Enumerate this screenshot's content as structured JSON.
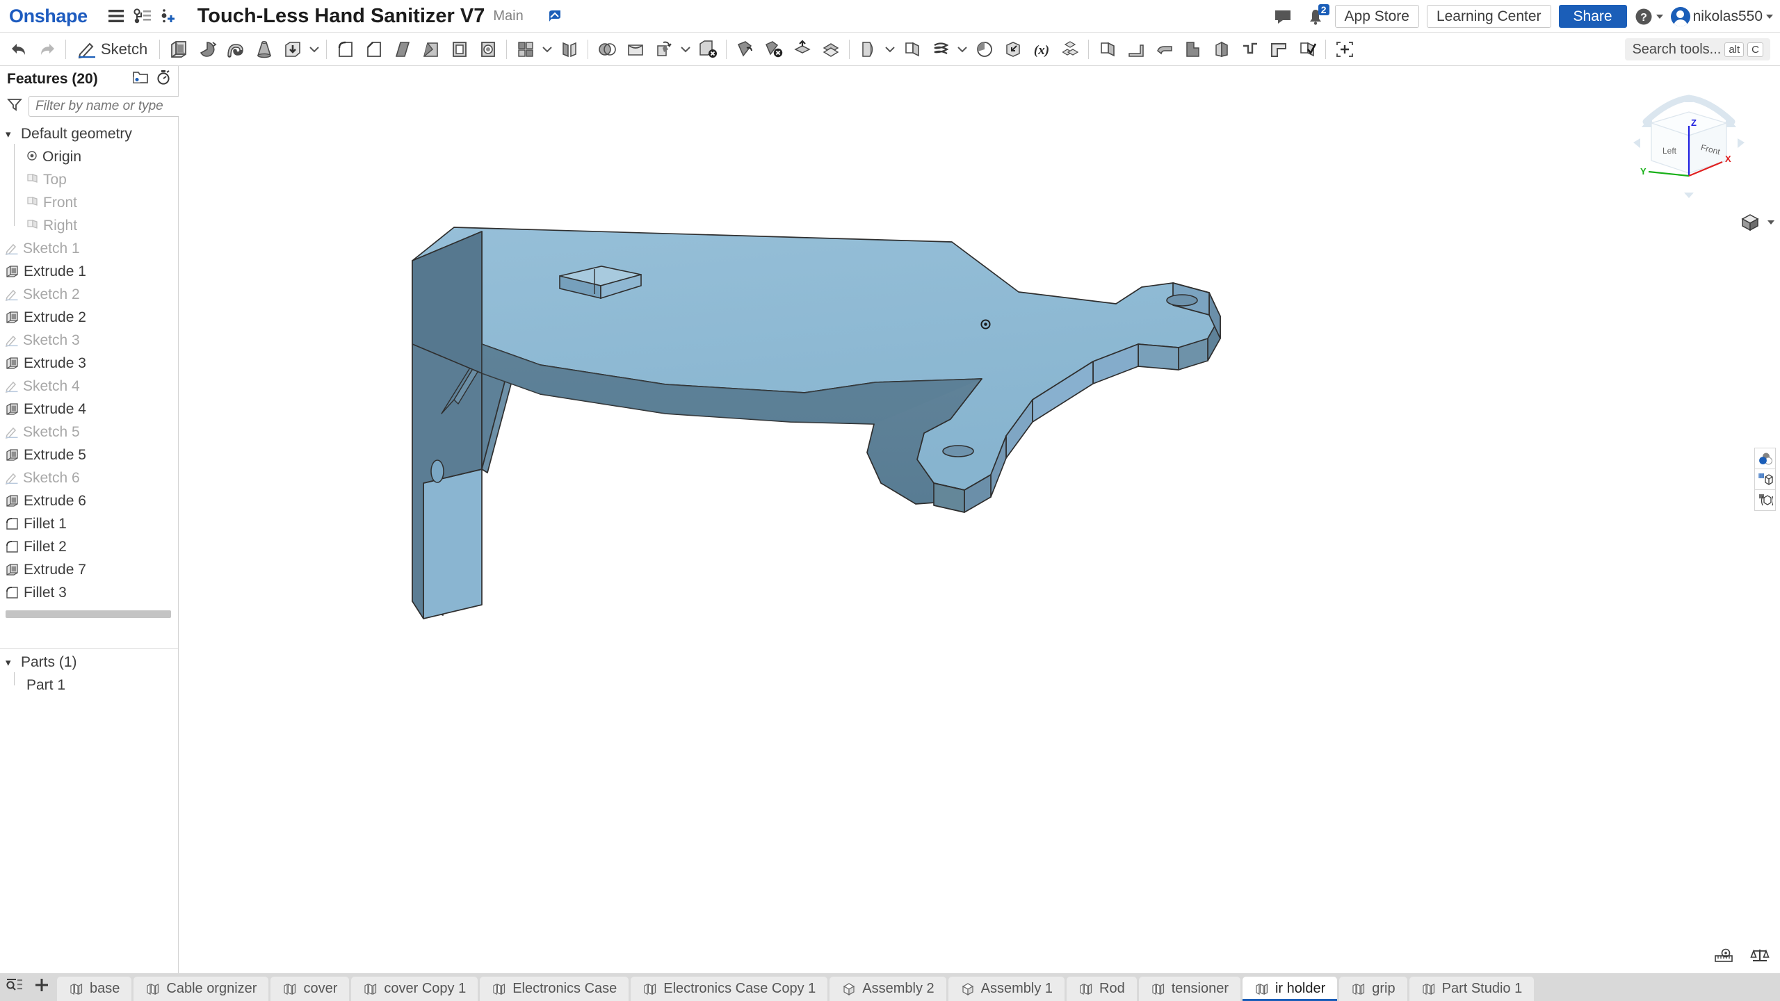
{
  "app": {
    "logo": "Onshape",
    "document_title": "Touch-Less Hand Sanitizer V7",
    "branch": "Main"
  },
  "topbar": {
    "icons": [
      {
        "name": "menu-icon",
        "label": "Menu"
      },
      {
        "name": "version-graph-icon",
        "label": "Versions and history"
      },
      {
        "name": "insert-version-icon",
        "label": "Add version"
      },
      {
        "name": "branch-icon",
        "label": "Branch"
      }
    ],
    "comments_icon": "comment-icon",
    "notifications_icon": "bell-icon",
    "notification_count": "2",
    "app_store_label": "App Store",
    "learning_center_label": "Learning Center",
    "share_label": "Share",
    "help_icon": "help-icon",
    "username": "nikolas550"
  },
  "toolbar": {
    "undo_icon": "undo-icon",
    "redo_icon": "redo-icon",
    "sketch_label": "Sketch",
    "sketch_icon": "sketch-pencil-icon",
    "groups": [
      {
        "name": "create-features",
        "tools": [
          {
            "name": "extrude-icon",
            "label": "Extrude"
          },
          {
            "name": "revolve-icon",
            "label": "Revolve"
          },
          {
            "name": "sweep-icon",
            "label": "Sweep"
          },
          {
            "name": "loft-icon",
            "label": "Loft"
          },
          {
            "name": "thicken-icon",
            "label": "Thicken"
          },
          {
            "name": "more-create-dropdown",
            "label": "More create"
          }
        ]
      },
      {
        "name": "modify-features",
        "tools": [
          {
            "name": "fillet-icon",
            "label": "Fillet"
          },
          {
            "name": "chamfer-icon",
            "label": "Chamfer"
          },
          {
            "name": "rib-icon",
            "label": "Rib"
          },
          {
            "name": "draft-icon",
            "label": "Draft"
          },
          {
            "name": "shell-icon",
            "label": "Shell"
          },
          {
            "name": "hole-icon",
            "label": "Hole"
          },
          {
            "name": "thread-icon",
            "label": "Thread"
          }
        ]
      },
      {
        "name": "pattern-features",
        "tools": [
          {
            "name": "pattern-icon",
            "label": "Pattern"
          },
          {
            "name": "pattern-dropdown",
            "label": "Pattern options"
          },
          {
            "name": "mirror-icon",
            "label": "Mirror"
          }
        ]
      },
      {
        "name": "boolean-features",
        "tools": [
          {
            "name": "boolean-icon",
            "label": "Boolean"
          },
          {
            "name": "split-icon",
            "label": "Split"
          },
          {
            "name": "transform-icon",
            "label": "Transform"
          },
          {
            "name": "transform-dropdown",
            "label": "Transform options"
          },
          {
            "name": "delete-part-icon",
            "label": "Delete part"
          }
        ]
      },
      {
        "name": "surface-features",
        "tools": [
          {
            "name": "move-face-icon",
            "label": "Move face"
          },
          {
            "name": "delete-face-icon",
            "label": "Delete face"
          },
          {
            "name": "replace-face-icon",
            "label": "Replace face"
          },
          {
            "name": "offset-surface-icon",
            "label": "Offset surface"
          }
        ]
      },
      {
        "name": "curve-features",
        "tools": [
          {
            "name": "enclose-icon",
            "label": "Enclose"
          },
          {
            "name": "enclose-dropdown",
            "label": "Enclose options"
          },
          {
            "name": "plane-icon",
            "label": "Plane"
          },
          {
            "name": "helix-icon",
            "label": "Helix"
          },
          {
            "name": "curve-dropdown",
            "label": "Curve options"
          },
          {
            "name": "sketch-pattern-icon",
            "label": "Use"
          },
          {
            "name": "derive-icon",
            "label": "Derive"
          },
          {
            "name": "variable-icon",
            "label": "Variable"
          },
          {
            "name": "composite-part-icon",
            "label": "Composite part"
          }
        ]
      },
      {
        "name": "sheetmetal-features",
        "tools": [
          {
            "name": "sheet-metal-model-icon",
            "label": "Sheet metal model"
          },
          {
            "name": "flange-icon",
            "label": "Flange"
          },
          {
            "name": "bend-icon",
            "label": "Bend"
          },
          {
            "name": "tab-icon",
            "label": "Tab"
          },
          {
            "name": "unfold-icon",
            "label": "Unfold"
          },
          {
            "name": "joint-icon",
            "label": "Joint"
          },
          {
            "name": "hem-icon",
            "label": "Hem"
          },
          {
            "name": "corner-relief-icon",
            "label": "Corner"
          },
          {
            "name": "sheet-metal-end-icon",
            "label": "End sheet metal"
          }
        ]
      },
      {
        "name": "utility",
        "tools": [
          {
            "name": "bounding-box-icon",
            "label": "Add custom feature"
          }
        ]
      }
    ],
    "search_placeholder": "Search tools...",
    "search_shortcut_alt": "alt",
    "search_shortcut_key": "C"
  },
  "feature_tree": {
    "title": "Features (20)",
    "add_folder_icon": "add-folder-icon",
    "rollback_icon": "stopwatch-icon",
    "filter_icon": "funnel-icon",
    "filter_placeholder": "Filter by name or type",
    "default_geometry": {
      "label": "Default geometry",
      "expanded": true,
      "children": [
        {
          "label": "Origin",
          "icon": "origin-icon",
          "dim": false
        },
        {
          "label": "Top",
          "icon": "plane-icon",
          "dim": true
        },
        {
          "label": "Front",
          "icon": "plane-icon",
          "dim": true
        },
        {
          "label": "Right",
          "icon": "plane-icon",
          "dim": true
        }
      ]
    },
    "features": [
      {
        "label": "Sketch 1",
        "icon": "sketch-icon",
        "dim": true
      },
      {
        "label": "Extrude 1",
        "icon": "extrude-icon",
        "dim": false
      },
      {
        "label": "Sketch 2",
        "icon": "sketch-icon",
        "dim": true
      },
      {
        "label": "Extrude 2",
        "icon": "extrude-icon",
        "dim": false
      },
      {
        "label": "Sketch 3",
        "icon": "sketch-icon",
        "dim": true
      },
      {
        "label": "Extrude 3",
        "icon": "extrude-icon",
        "dim": false
      },
      {
        "label": "Sketch 4",
        "icon": "sketch-icon",
        "dim": true
      },
      {
        "label": "Extrude 4",
        "icon": "extrude-icon",
        "dim": false
      },
      {
        "label": "Sketch 5",
        "icon": "sketch-icon",
        "dim": true
      },
      {
        "label": "Extrude 5",
        "icon": "extrude-icon",
        "dim": false
      },
      {
        "label": "Sketch 6",
        "icon": "sketch-icon",
        "dim": true
      },
      {
        "label": "Extrude 6",
        "icon": "extrude-icon",
        "dim": false
      },
      {
        "label": "Fillet 1",
        "icon": "fillet-icon",
        "dim": false
      },
      {
        "label": "Fillet 2",
        "icon": "fillet-icon",
        "dim": false
      },
      {
        "label": "Extrude 7",
        "icon": "extrude-icon",
        "dim": false
      },
      {
        "label": "Fillet 3",
        "icon": "fillet-icon",
        "dim": false
      }
    ],
    "parts": {
      "label": "Parts (1)",
      "expanded": true,
      "items": [
        {
          "label": "Part 1"
        }
      ]
    },
    "collapse_button_icon": "list-toggle-icon"
  },
  "viewport": {
    "model_name": "Part 1",
    "face_color_top": "#8fbad5",
    "face_color_side": "#5d8097",
    "face_color_dark": "#50728a",
    "edge_color": "#2b2b2b",
    "background": "#ffffff",
    "view_cube": {
      "visible_faces": [
        "Left",
        "Front"
      ],
      "axes": [
        {
          "label": "X",
          "color": "#e02020"
        },
        {
          "label": "Y",
          "color": "#18b018"
        },
        {
          "label": "Z",
          "color": "#2020e0"
        }
      ]
    },
    "display_mode_icon": "shaded-cube-icon",
    "right_rail": [
      {
        "name": "appearance-icon",
        "label": "Appearance"
      },
      {
        "name": "render-studio-icon",
        "label": "Render"
      },
      {
        "name": "simulation-icon",
        "label": "Simulation"
      }
    ],
    "bottom_icons": [
      {
        "name": "measure-icon",
        "label": "Measure"
      },
      {
        "name": "mass-properties-icon",
        "label": "Mass properties"
      }
    ],
    "cursor_marker": "origin-cursor-icon"
  },
  "tabbar": {
    "tab_list_icon": "tab-list-icon",
    "add_tab_icon": "plus-icon",
    "tabs": [
      {
        "label": "base",
        "icon": "part-studio-icon",
        "active": false
      },
      {
        "label": "Cable orgnizer",
        "icon": "part-studio-icon",
        "active": false
      },
      {
        "label": "cover",
        "icon": "part-studio-icon",
        "active": false
      },
      {
        "label": "cover Copy 1",
        "icon": "part-studio-icon",
        "active": false
      },
      {
        "label": "Electronics Case",
        "icon": "part-studio-icon",
        "active": false
      },
      {
        "label": "Electronics Case Copy 1",
        "icon": "part-studio-icon",
        "active": false
      },
      {
        "label": "Assembly 2",
        "icon": "assembly-icon",
        "active": false
      },
      {
        "label": "Assembly 1",
        "icon": "assembly-icon",
        "active": false
      },
      {
        "label": "Rod",
        "icon": "part-studio-icon",
        "active": false
      },
      {
        "label": "tensioner",
        "icon": "part-studio-icon",
        "active": false
      },
      {
        "label": "ir holder",
        "icon": "part-studio-icon",
        "active": true
      },
      {
        "label": "grip",
        "icon": "part-studio-icon",
        "active": false
      },
      {
        "label": "Part Studio 1",
        "icon": "part-studio-icon",
        "active": false
      }
    ]
  }
}
